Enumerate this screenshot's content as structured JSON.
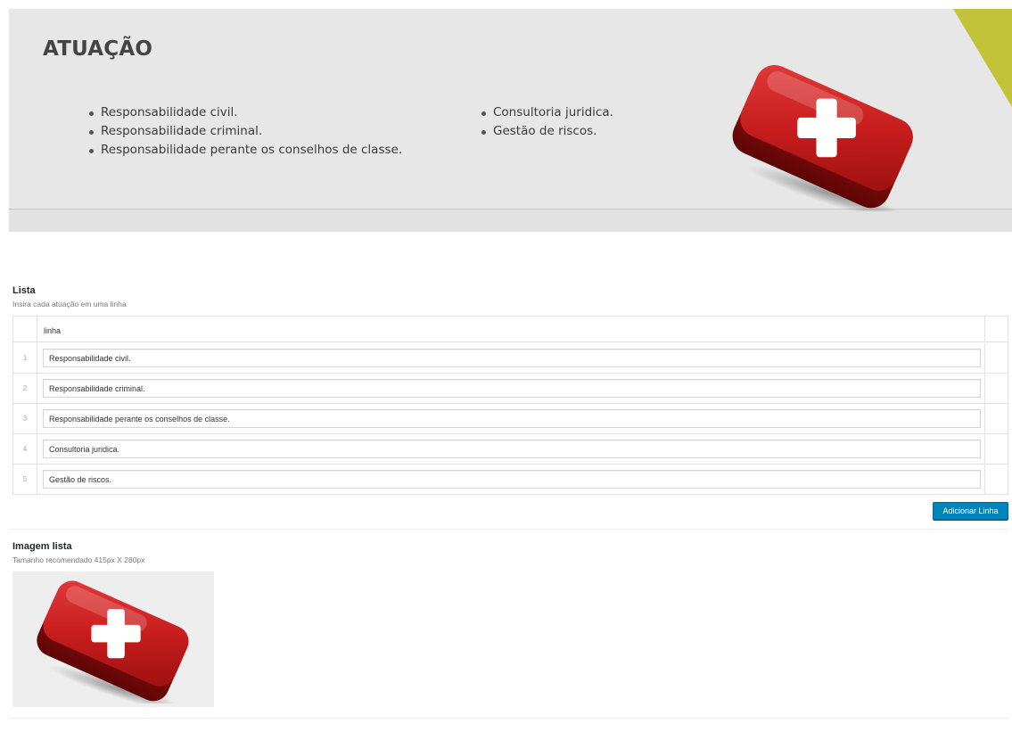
{
  "preview": {
    "title": "ATUAÇÃO",
    "image_icon": "first-aid-kit-icon",
    "column_a": [
      "Responsabilidade civil.",
      "Responsabilidade criminal.",
      "Responsabilidade perante os conselhos de classe."
    ],
    "column_b": [
      "Consultoria juridica.",
      "Gestão de riscos."
    ],
    "accent_color": "#c3c33a"
  },
  "lista": {
    "label": "Lista",
    "description": "Insira cada atuação em uma linha",
    "column_header": "linha",
    "rows": [
      {
        "num": "1",
        "value": "Responsabilidade civil."
      },
      {
        "num": "2",
        "value": "Responsabilidade criminal."
      },
      {
        "num": "3",
        "value": "Responsabilidade perante os conselhos de classe."
      },
      {
        "num": "4",
        "value": "Consultoria juridica."
      },
      {
        "num": "5",
        "value": "Gestão de riscos."
      }
    ],
    "add_button": "Adicionar Linha",
    "button_color": "#0085ba"
  },
  "imagem": {
    "label": "Imagem lista",
    "description": "Tamanho recomendado 415px X 280px",
    "image_icon": "first-aid-kit-icon"
  }
}
